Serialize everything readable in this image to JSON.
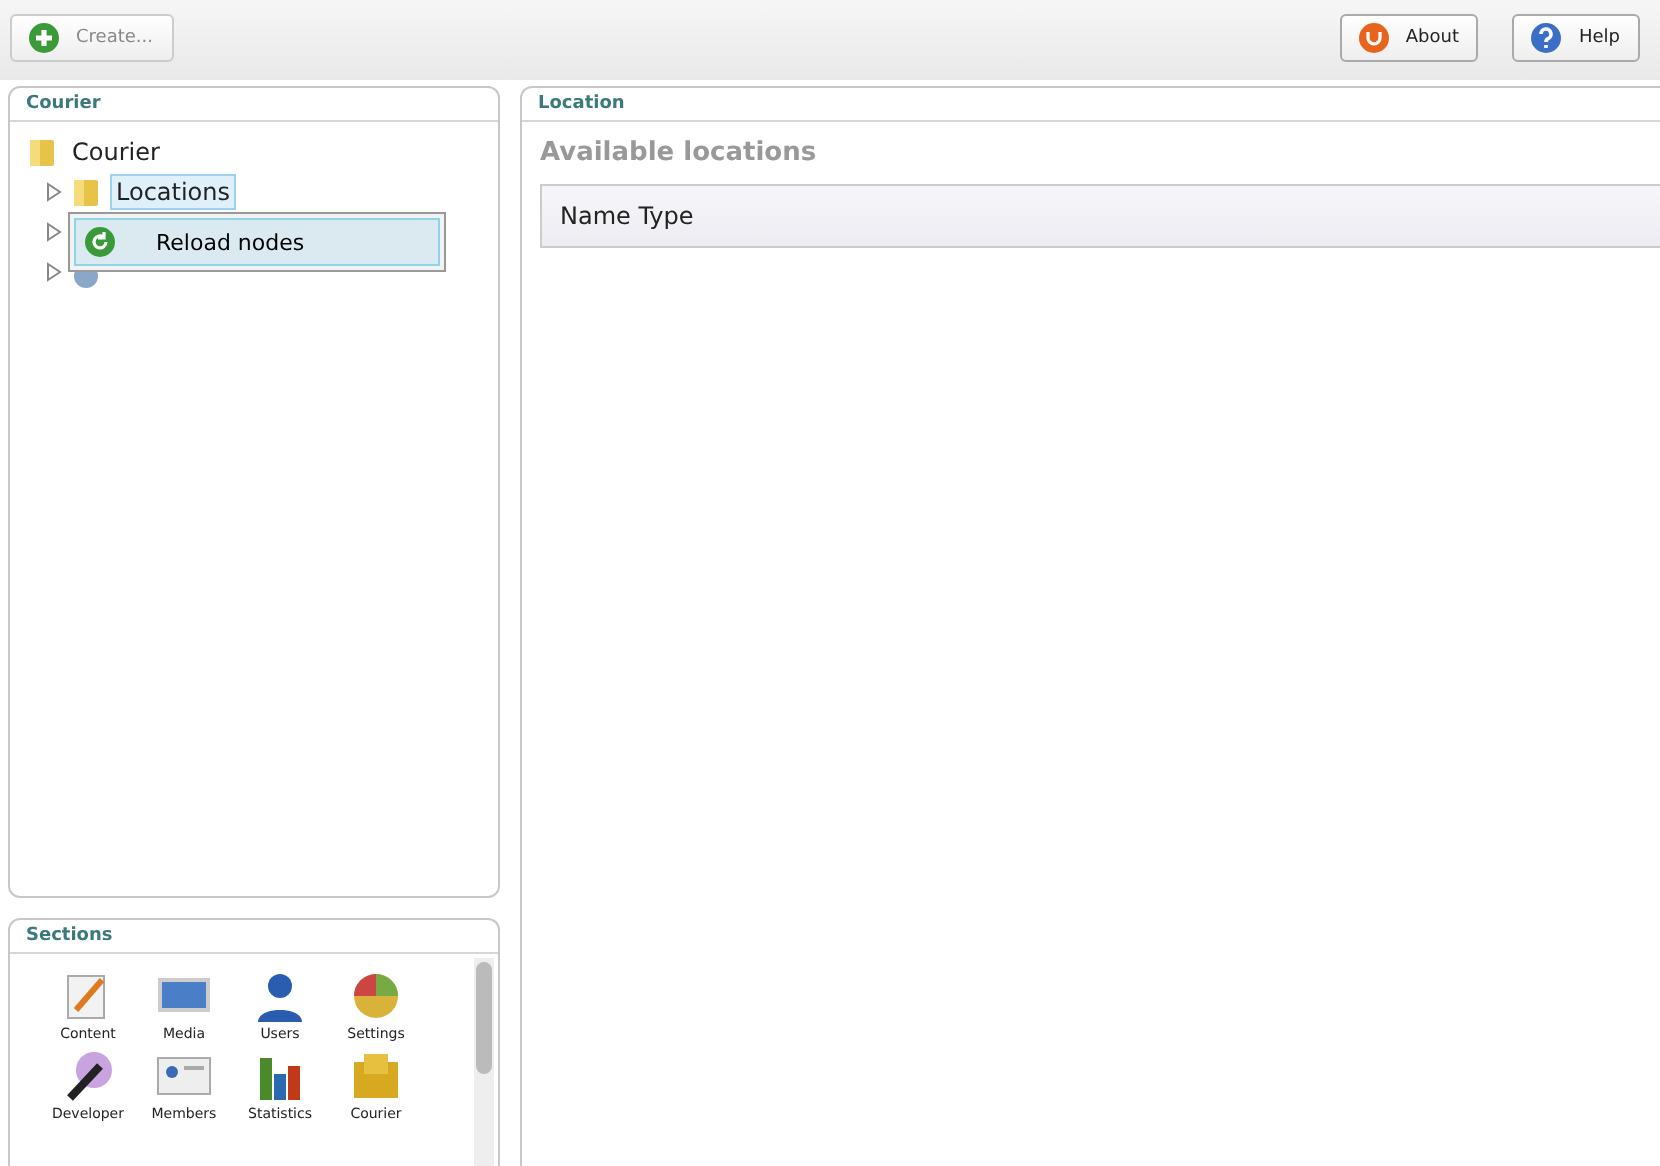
{
  "toolbar": {
    "create": {
      "label": "Create...",
      "disabled": true
    },
    "buttons": [
      {
        "label": "About",
        "kind": "about"
      },
      {
        "label": "Help",
        "kind": "help"
      }
    ]
  },
  "tree_panel": {
    "title": "Courier",
    "tree": [
      {
        "label": "Courier",
        "selected": false,
        "children": [
          {
            "label": "Locations",
            "selected": true,
            "kind": "folder"
          },
          {
            "kind": "none"
          },
          {
            "kind": "gear"
          }
        ]
      }
    ]
  },
  "context_menu": {
    "items": [
      {
        "label": "Reload nodes",
        "selected": true
      }
    ]
  },
  "sections": {
    "title": "Sections",
    "items": [
      {
        "label": "Content",
        "kind": "content"
      },
      {
        "label": "Media",
        "kind": "media"
      },
      {
        "label": "Users",
        "kind": "users"
      },
      {
        "label": "Settings",
        "kind": "settings"
      },
      {
        "label": "Developer",
        "kind": "developer"
      },
      {
        "label": "Members",
        "kind": "members"
      },
      {
        "label": "Statistics",
        "kind": "statistics"
      },
      {
        "label": "Courier",
        "kind": "courier"
      }
    ]
  },
  "main_panel": {
    "title": "Location",
    "heading": "Available locations",
    "table": {
      "header": "Name Type"
    }
  }
}
